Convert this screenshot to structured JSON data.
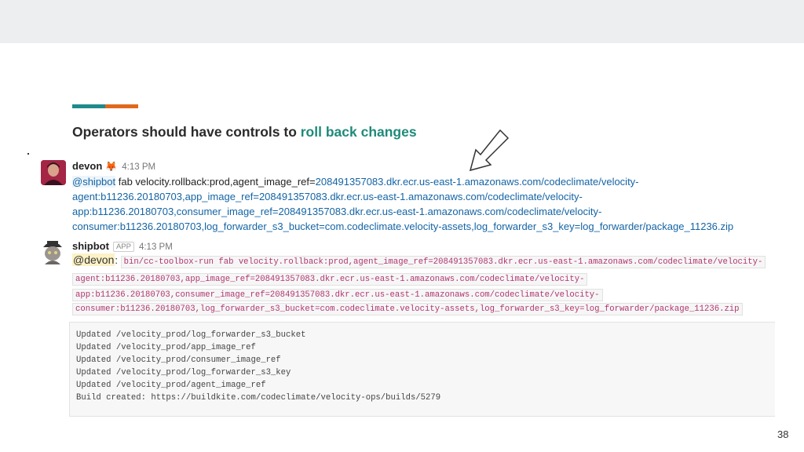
{
  "slide": {
    "title_prefix": "Operators should have controls to ",
    "title_highlight": "roll back changes",
    "page_number": "38"
  },
  "messages": {
    "devon": {
      "username": "devon",
      "emoji": "fox-emoji",
      "time": "4:13 PM",
      "mention": "@shipbot",
      "lines": [
        {
          "pre": " fab velocity.rollback:prod,agent_image_ref=",
          "link": "208491357083.dkr.ecr.us-east-1.amazonaws.com/codeclimate/velocity-"
        },
        {
          "pre": "",
          "link": "agent:b11236.20180703,app_image_ref=208491357083.dkr.ecr.us-east-1.amazonaws.com/codeclimate/velocity-"
        },
        {
          "pre": "",
          "link": "app:b11236.20180703,consumer_image_ref=208491357083.dkr.ecr.us-east-1.amazonaws.com/codeclimate/velocity-"
        },
        {
          "pre": "",
          "link": "consumer:b11236.20180703,log_forwarder_s3_bucket=com.codeclimate.velocity-assets,log_forwarder_s3_key=log_forwarder/package_11236.zip"
        }
      ]
    },
    "shipbot": {
      "username": "shipbot",
      "badge": "APP",
      "time": "4:13 PM",
      "mention": "@devon",
      "colon": ":",
      "code_lines": [
        "bin/cc-toolbox-run fab velocity.rollback:prod,agent_image_ref=208491357083.dkr.ecr.us-east-1.amazonaws.com/codeclimate/velocity-",
        "agent:b11236.20180703,app_image_ref=208491357083.dkr.ecr.us-east-1.amazonaws.com/codeclimate/velocity-",
        "app:b11236.20180703,consumer_image_ref=208491357083.dkr.ecr.us-east-1.amazonaws.com/codeclimate/velocity-",
        "consumer:b11236.20180703,log_forwarder_s3_bucket=com.codeclimate.velocity-assets,log_forwarder_s3_key=log_forwarder/package_11236.zip"
      ],
      "output_lines": [
        "Updated /velocity_prod/log_forwarder_s3_bucket",
        "Updated /velocity_prod/app_image_ref",
        "Updated /velocity_prod/consumer_image_ref",
        "Updated /velocity_prod/log_forwarder_s3_key",
        "Updated /velocity_prod/agent_image_ref",
        "Build created: https://buildkite.com/codeclimate/velocity-ops/builds/5279"
      ]
    }
  },
  "colors": {
    "accent_teal": "#1f8a8a",
    "accent_orange": "#e0681c",
    "highlight_text": "#1f8a7a",
    "link": "#1464a5",
    "code_text": "#b0366e"
  }
}
